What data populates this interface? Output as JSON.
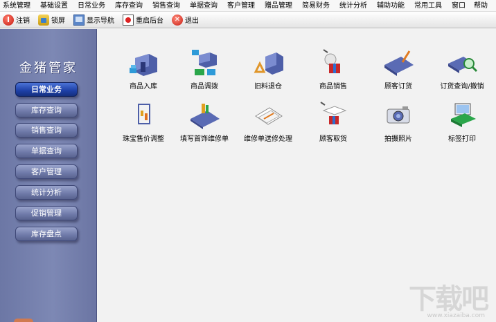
{
  "menubar": {
    "items": [
      "系统管理",
      "基础设置",
      "日常业务",
      "库存查询",
      "销售查询",
      "单据查询",
      "客户管理",
      "赠品管理",
      "简易财务",
      "统计分析",
      "辅助功能",
      "常用工具",
      "窗口",
      "帮助"
    ]
  },
  "toolbar": {
    "buttons": [
      {
        "label": "注销",
        "icon": "power-icon"
      },
      {
        "label": "锁屏",
        "icon": "lock-icon"
      },
      {
        "label": "显示导航",
        "icon": "navigation-icon"
      },
      {
        "label": "重启后台",
        "icon": "restart-icon"
      },
      {
        "label": "退出",
        "icon": "exit-icon"
      }
    ]
  },
  "sidebar": {
    "brand": "金猪管家",
    "items": [
      "日常业务",
      "库存查询",
      "销售查询",
      "单据查询",
      "客户管理",
      "统计分析",
      "促销管理",
      "库存盘点"
    ],
    "active_index": 0
  },
  "tiles": [
    {
      "label": "商品入库",
      "icon": "warehouse-inbound-icon"
    },
    {
      "label": "商品调拨",
      "icon": "goods-transfer-icon"
    },
    {
      "label": "旧料退仓",
      "icon": "recycle-return-icon"
    },
    {
      "label": "商品销售",
      "icon": "goods-sale-icon"
    },
    {
      "label": "顾客订货",
      "icon": "customer-order-icon"
    },
    {
      "label": "订货查询/撤销",
      "icon": "order-search-icon"
    },
    {
      "label": "珠宝售价调整",
      "icon": "price-adjust-icon"
    },
    {
      "label": "填写首饰维修单",
      "icon": "repair-form-icon"
    },
    {
      "label": "维修单送修处理",
      "icon": "repair-process-icon"
    },
    {
      "label": "顾客取货",
      "icon": "customer-pickup-icon"
    },
    {
      "label": "拍摄照片",
      "icon": "camera-icon"
    },
    {
      "label": "标签打印",
      "icon": "label-print-icon"
    }
  ],
  "watermark": {
    "text": "下载吧",
    "url": "www.xiazaiba.com"
  }
}
